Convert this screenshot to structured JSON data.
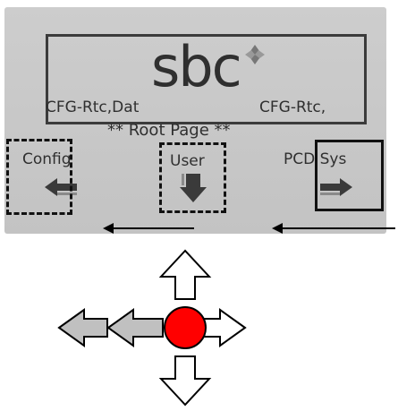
{
  "lcd": {
    "logo_text": "sbc",
    "status_left": "CFG-Rtc,Dat",
    "status_right": "CFG-Rtc,",
    "page_title": "** Root Page **"
  },
  "softkeys": {
    "left": {
      "label": "Config",
      "icon": "arrow-left-icon"
    },
    "center": {
      "label": "User",
      "icon": "arrow-down-icon"
    },
    "right": {
      "label": "PCD Sys",
      "icon": "arrow-right-icon"
    }
  },
  "nav_pad": {
    "center_color": "#ff0000",
    "outline_arrow_color": "#ffffff",
    "inactive_arrow_color": "#c0c0c0"
  },
  "colors": {
    "lcd_bg": "#c8c8c8",
    "lcd_text": "#2f2f2f"
  }
}
